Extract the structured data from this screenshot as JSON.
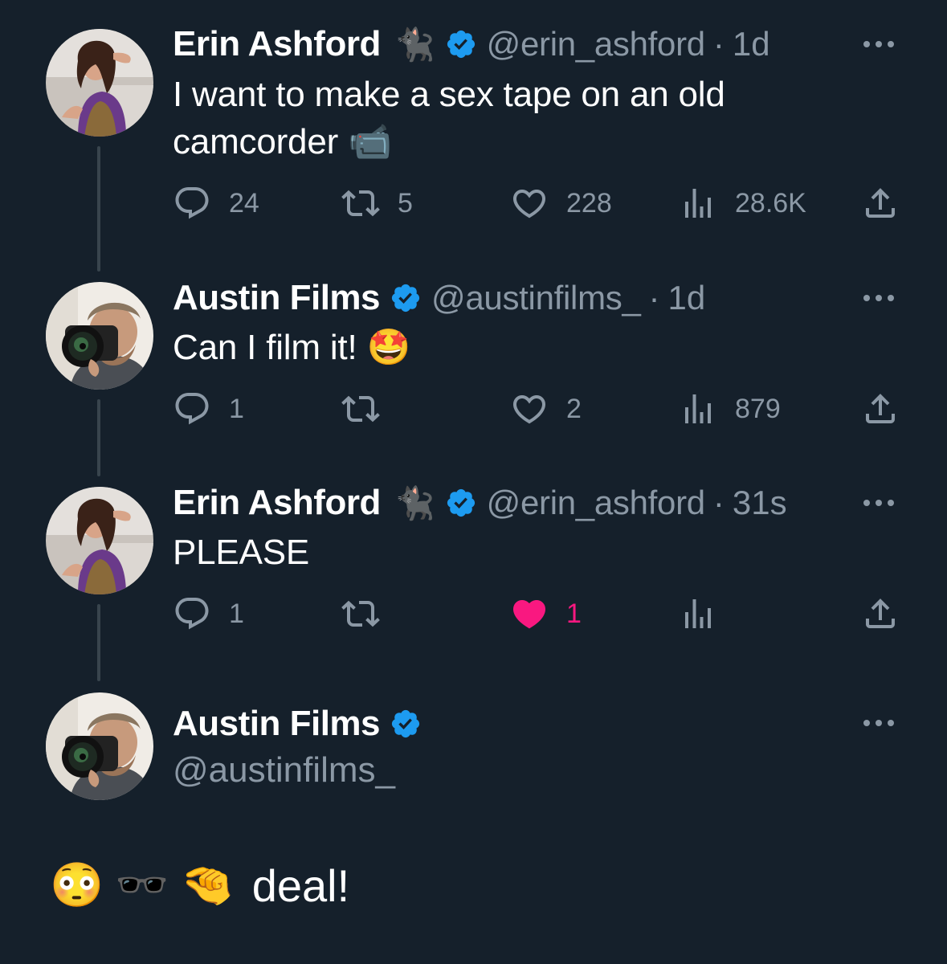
{
  "tweets": [
    {
      "name": "Erin Ashford",
      "name_emoji": "🐈‍⬛",
      "handle": "@erin_ashford",
      "separator": "·",
      "time": "1d",
      "text_lines": [
        "I want to make a sex tape on an old",
        "camcorder 📹"
      ],
      "reply_count": "24",
      "retweet_count": "5",
      "like_count": "228",
      "view_count": "28.6K",
      "liked": false
    },
    {
      "name": "Austin Films",
      "handle": "@austinfilms_",
      "separator": "·",
      "time": "1d",
      "text_lines": [
        "Can I film it! 🤩"
      ],
      "reply_count": "1",
      "retweet_count": "",
      "like_count": "2",
      "view_count": "879",
      "liked": false
    },
    {
      "name": "Erin Ashford",
      "name_emoji": "🐈‍⬛",
      "handle": "@erin_ashford",
      "separator": "·",
      "time": "31s",
      "text_lines": [
        "PLEASE"
      ],
      "reply_count": "1",
      "retweet_count": "",
      "like_count": "1",
      "view_count": "",
      "liked": true
    }
  ],
  "reply": {
    "name": "Austin Films",
    "handle": "@austinfilms_",
    "emojis": [
      "😳",
      "🕶️",
      "🤏"
    ],
    "text": "deal!"
  },
  "colors": {
    "background": "#15202b",
    "secondary_text": "#8b98a5",
    "verified_blue": "#1d9bf0",
    "like_pink": "#f91880",
    "thread_line": "#38444d"
  },
  "icons": [
    "reply-icon",
    "retweet-icon",
    "like-icon",
    "views-icon",
    "share-icon",
    "verified-icon",
    "more-icon"
  ]
}
